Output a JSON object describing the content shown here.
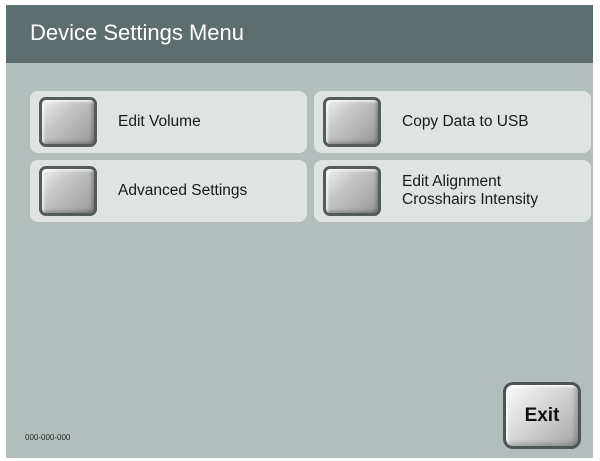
{
  "header": {
    "title": "Device Settings Menu"
  },
  "menu": {
    "edit_volume": "Edit Volume",
    "copy_data": "Copy Data to USB",
    "advanced_settings": "Advanced Settings",
    "edit_alignment": "Edit Alignment\nCrosshairs Intensity"
  },
  "footer": {
    "code": "000-000-000",
    "exit_label": "Exit"
  },
  "colors": {
    "title_bar": "#5d6e6e",
    "background": "#b3bdbc",
    "button_bg": "#dfe4e3"
  },
  "icons": {
    "button_square": "gray-square-button-icon"
  }
}
